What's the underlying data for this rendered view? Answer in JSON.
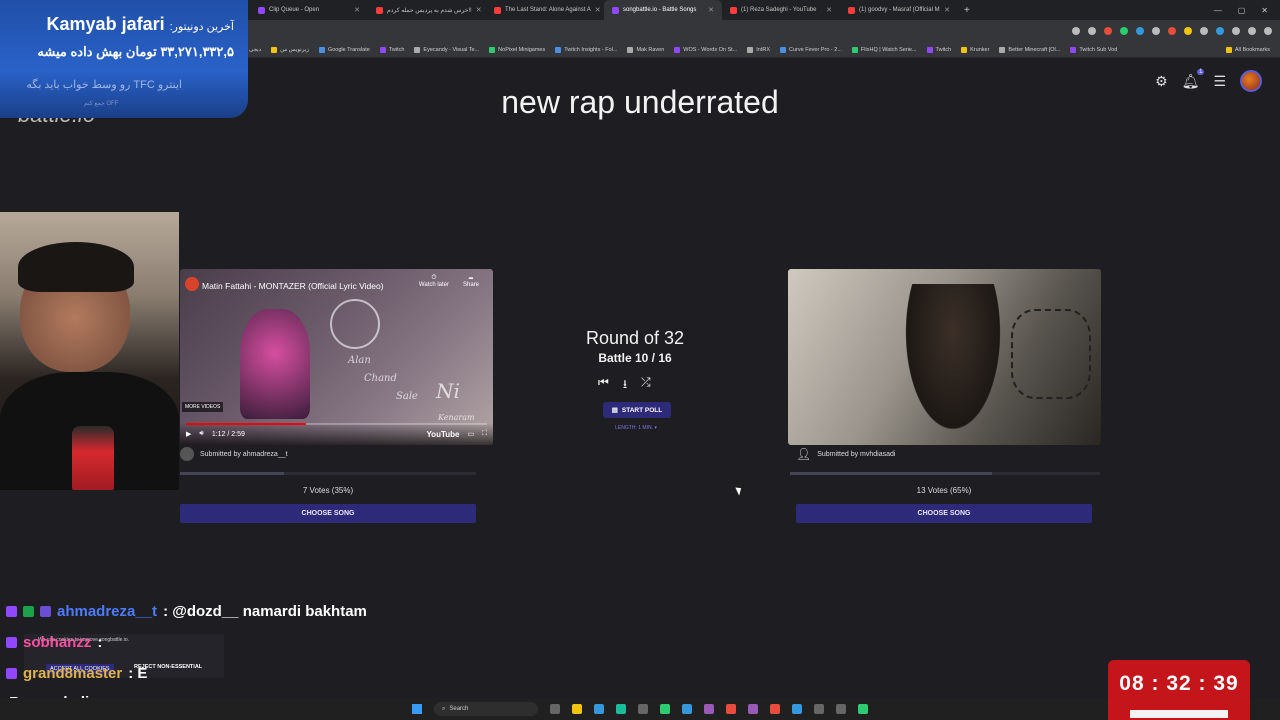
{
  "browser": {
    "tabs": [
      {
        "label": "Clip Queue - Open",
        "active": false,
        "icon": "twitch-icon"
      },
      {
        "label": "خرس شدم به پردیس حمله کردم!!",
        "active": false,
        "icon": "youtube-icon"
      },
      {
        "label": "The Last Stand: Alone Against A",
        "active": false,
        "icon": "youtube-icon"
      },
      {
        "label": "songbattle.io - Battle Songs",
        "active": true,
        "icon": "songbattle-icon"
      },
      {
        "label": "(1) Reza Sadeghi - YouTube",
        "active": false,
        "icon": "youtube-icon"
      },
      {
        "label": "(1) goodvy - Masraf (Official M",
        "active": false,
        "icon": "youtube-icon"
      }
    ],
    "bookmarks": [
      {
        "label": "دیجی",
        "icon": "gray"
      },
      {
        "label": "زیرنویس من",
        "icon": "yellow"
      },
      {
        "label": "Google Translate",
        "icon": "blue"
      },
      {
        "label": "Twitch",
        "icon": "purple"
      },
      {
        "label": "Eyecandy - Visual Te...",
        "icon": "gray"
      },
      {
        "label": "NoPixel Minigames",
        "icon": "green"
      },
      {
        "label": "Twitch Insights - Fol...",
        "icon": "blue"
      },
      {
        "label": "Mak Raven",
        "icon": "gray"
      },
      {
        "label": "WOS - Words On St...",
        "icon": "purple"
      },
      {
        "label": "IntRX",
        "icon": "gray"
      },
      {
        "label": "Curve Fever Pro - 2...",
        "icon": "blue"
      },
      {
        "label": "FlixHQ | Watch Serie...",
        "icon": "green"
      },
      {
        "label": "Twitch",
        "icon": "purple"
      },
      {
        "label": "Krunker",
        "icon": "yellow"
      },
      {
        "label": "Better Minecraft [Ol...",
        "icon": "gray"
      },
      {
        "label": "Twitch Sub Vod",
        "icon": "purple"
      }
    ],
    "all_bookmarks": "All Bookmarks"
  },
  "page": {
    "logo": "battle.io",
    "title": "new rap underrated",
    "notification_count": "1",
    "round": "Round of 32",
    "battle": "Battle 10 / 16",
    "start_poll": "START POLL",
    "length": "LENGTH: 1 MIN. ▾"
  },
  "left_song": {
    "video_title": "Matin Fattahi - MONTAZER (Official Lyric Video)",
    "watch_later": "Watch later",
    "share": "Share",
    "more_videos": "MORE VIDEOS",
    "time": "1:12 / 2:59",
    "youtube": "YouTube",
    "progress": 0.4,
    "art_text": [
      "Alan",
      "Chand",
      "Sale",
      "Ni",
      "Kenaram"
    ],
    "submitted_by": "Submitted by ahmadreza__t",
    "votes": "7 Votes (35%)",
    "vote_fraction": 0.35,
    "choose": "CHOOSE SONG"
  },
  "right_song": {
    "submitted_by": "Submitted by mvhdiasadi",
    "votes": "13 Votes (65%)",
    "vote_fraction": 0.65,
    "choose": "CHOOSE SONG"
  },
  "donation": {
    "label": "آخرین دونیتور:",
    "name": "Kamyab jafari",
    "amount": "۳۳,۲۷۱,۳۳۲,۵ تومان بهش داده میشه",
    "message": "اینترو TFC رو وسط خواب باید بگه",
    "sub": "OFF جمع کنم"
  },
  "chat": [
    {
      "name": "ahmadreza__t",
      "color": "#4b7bff",
      "message": ": @dozd__ namardi bakhtam",
      "badges": [
        "p",
        "g",
        "v"
      ]
    },
    {
      "name": "sobhanzz",
      "color": "#ff4fa3",
      "message": ":",
      "badges": [
        "p"
      ]
    },
    {
      "name": "grand8master",
      "color": "#e0b34a",
      "message": ": E",
      "badges": [
        "p"
      ]
    }
  ],
  "cookie": {
    "text": "We use cookies to improve songbattle.io.",
    "accept": "ACCEPT ALL COOKIES",
    "reject": "REJECT NON-ESSENTIAL"
  },
  "followby": "oBy : makoli",
  "timer": "08 : 32 : 39",
  "taskbar": {
    "search": "Search"
  }
}
